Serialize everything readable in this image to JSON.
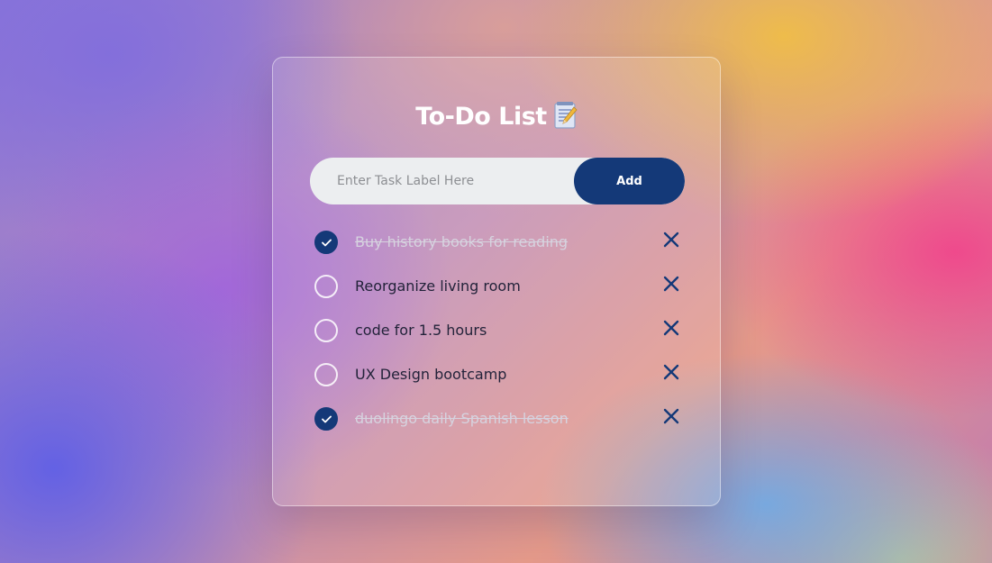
{
  "app": {
    "title": "To-Do List"
  },
  "input": {
    "placeholder": "Enter Task Label Here",
    "value": "",
    "add_label": "Add"
  },
  "tasks": [
    {
      "label": "Buy history books for reading",
      "done": true
    },
    {
      "label": "Reorganize living room",
      "done": false
    },
    {
      "label": "code for 1.5 hours",
      "done": false
    },
    {
      "label": "UX Design bootcamp",
      "done": false
    },
    {
      "label": "duolingo daily Spanish lesson",
      "done": true
    }
  ],
  "icons": {
    "title_icon": "memo-icon",
    "check_icon": "checkmark-icon",
    "delete_icon": "close-icon"
  },
  "colors": {
    "accent": "#143978",
    "input_bg": "#eceef0",
    "done_text": "#d6d3df",
    "text": "#23233a"
  }
}
